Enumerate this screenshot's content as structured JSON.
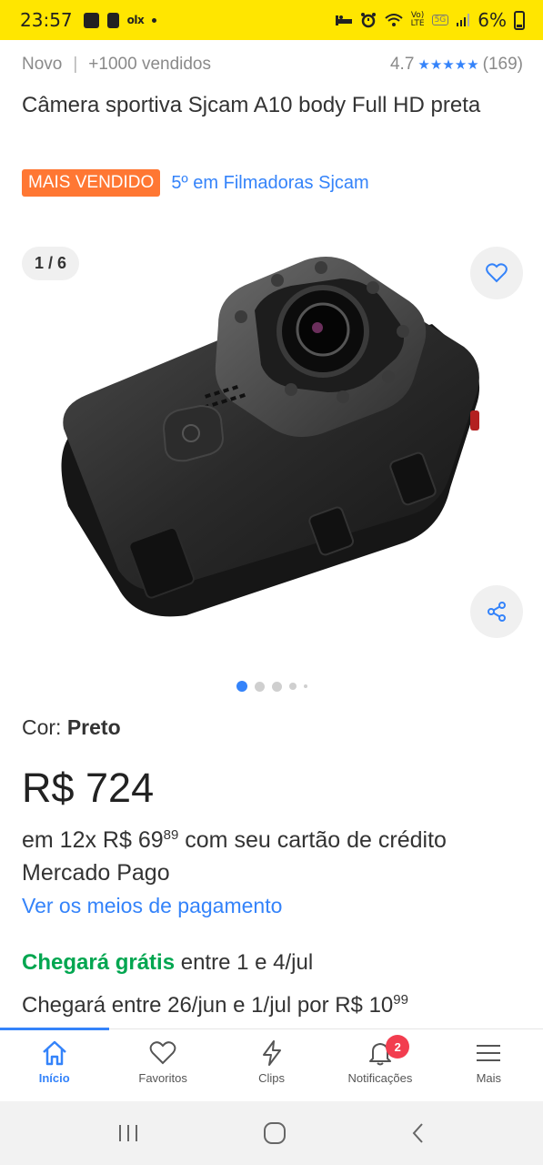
{
  "status_bar": {
    "time": "23:57",
    "app_badge": "olx",
    "network_label": "LTE",
    "network_5g": "5G",
    "battery": "6%"
  },
  "product": {
    "condition": "Novo",
    "sold": "+1000 vendidos",
    "rating": "4.7",
    "stars": "★★★★★",
    "reviews": "(169)",
    "title": "Câmera sportiva Sjcam A10 body Full HD preta",
    "badge": "MAIS VENDIDO",
    "ranking": "5º em Filmadoras Sjcam",
    "image_counter": "1 / 6",
    "image_total": 6,
    "image_current": 1,
    "color_label": "Cor:",
    "color_value": "Preto",
    "price": "R$ 724",
    "installments_prefix": "em 12x R$ 69",
    "installments_cents": "89",
    "installments_suffix": " com seu cartão de crédito Mercado Pago",
    "payment_link": "Ver os meios de pagamento",
    "shipping_free": "Chegará grátis",
    "shipping_free_dates": " entre 1 e 4/jul",
    "shipping_paid_prefix": "Chegará entre 26/jun e 1/jul por R$ 10",
    "shipping_paid_cents": "99"
  },
  "bottom_nav": {
    "items": [
      {
        "label": "Início",
        "icon": "home-icon",
        "active": true
      },
      {
        "label": "Favoritos",
        "icon": "heart-icon",
        "active": false
      },
      {
        "label": "Clips",
        "icon": "lightning-icon",
        "active": false
      },
      {
        "label": "Notificações",
        "icon": "bell-icon",
        "active": false,
        "badge": "2"
      },
      {
        "label": "Mais",
        "icon": "menu-icon",
        "active": false
      }
    ]
  },
  "colors": {
    "brand_yellow": "#ffe600",
    "link_blue": "#3483fa",
    "badge_orange": "#ff7733",
    "free_green": "#00a650",
    "notification_red": "#f23d4f"
  }
}
